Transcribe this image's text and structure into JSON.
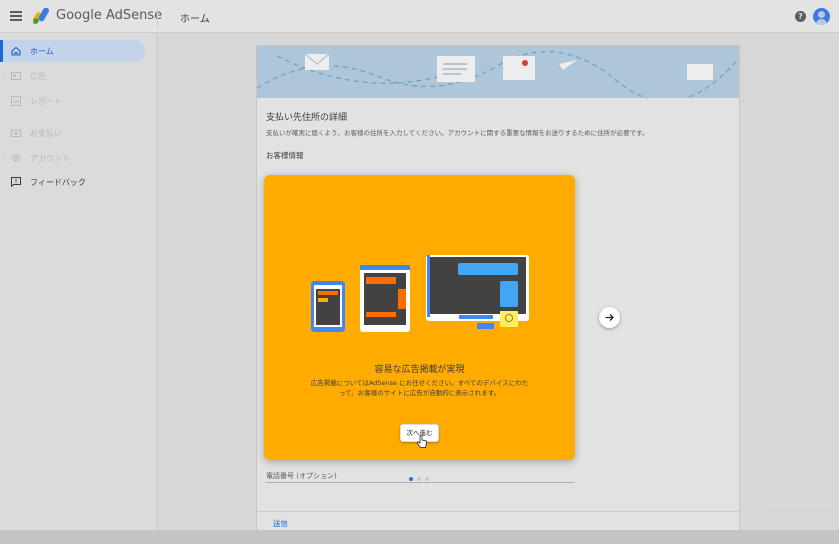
{
  "header": {
    "brand": "Google AdSense",
    "page_title": "ホーム",
    "help_glyph": "?"
  },
  "sidebar": {
    "items": [
      {
        "label": "ホーム",
        "icon": "home-icon",
        "state": "active"
      },
      {
        "label": "広告",
        "icon": "ads-icon",
        "state": "disabled"
      },
      {
        "label": "レポート",
        "icon": "reports-icon",
        "state": "disabled"
      },
      {
        "label": "お支払い",
        "icon": "payments-icon",
        "state": "disabled"
      },
      {
        "label": "アカウント",
        "icon": "gear-icon",
        "state": "disabled"
      },
      {
        "label": "フィードバック",
        "icon": "feedback-icon",
        "state": "normal"
      }
    ]
  },
  "main": {
    "section_title": "支払い先住所の詳細",
    "section_desc": "支払いが確実に届くよう、お客様の住所を入力してください。アカウントに関する重要な情報をお送りするために住所が必要です。",
    "sub_label": "お客様情報",
    "phone_label": "電話番号 (オプション)",
    "submit_label": "送信"
  },
  "modal": {
    "title": "容易な広告掲載が実現",
    "body": "広告掲載についてはAdSense にお任せください。すべてのデバイスにわたって、お客様のサイトに広告が自動的に表示されます。",
    "next_label": "次へ進む",
    "pager": {
      "current": 1,
      "total": 3
    }
  },
  "colors": {
    "accent": "#1a73e8",
    "modal_bg": "#ffab00",
    "banner_bg": "#bcd6ea",
    "active_nav_bg": "#d2e3fc"
  }
}
